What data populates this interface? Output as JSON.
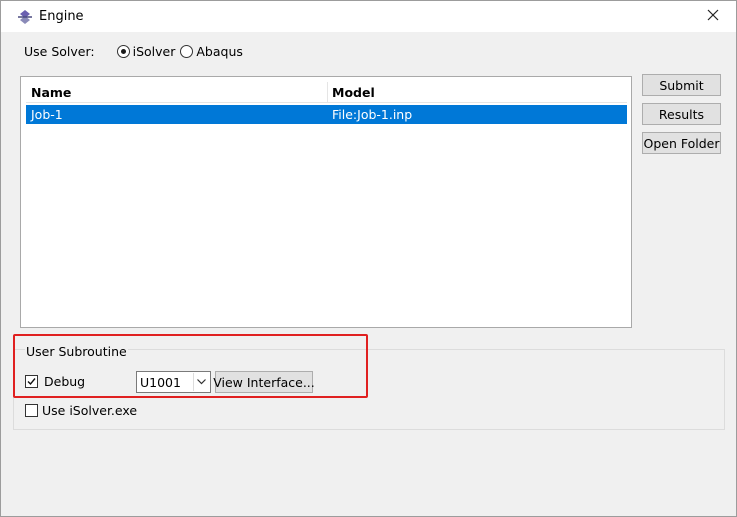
{
  "window": {
    "title": "Engine",
    "close_symbol": "✕"
  },
  "solver": {
    "label": "Use Solver:",
    "options": [
      {
        "label": "iSolver",
        "selected": true
      },
      {
        "label": "Abaqus",
        "selected": false
      }
    ]
  },
  "jobs": {
    "columns": [
      "Name",
      "Model"
    ],
    "rows": [
      {
        "name": "Job-1",
        "model": "File:Job-1.inp",
        "selected": true
      }
    ]
  },
  "buttons": {
    "submit": "Submit",
    "results": "Results",
    "open_folder": "Open Folder"
  },
  "subroutine": {
    "group_label": "User Subroutine",
    "debug_label": "Debug",
    "debug_checked": true,
    "combo_value": "U1001",
    "view_interface": "View Interface..."
  },
  "use_isolver": {
    "label": "Use iSolver.exe",
    "checked": false
  },
  "colors": {
    "selection": "#0078d7",
    "highlight": "#e02020"
  },
  "icons": [
    "app-icon",
    "close-icon",
    "dropdown-arrow-icon",
    "checkmark-icon"
  ]
}
